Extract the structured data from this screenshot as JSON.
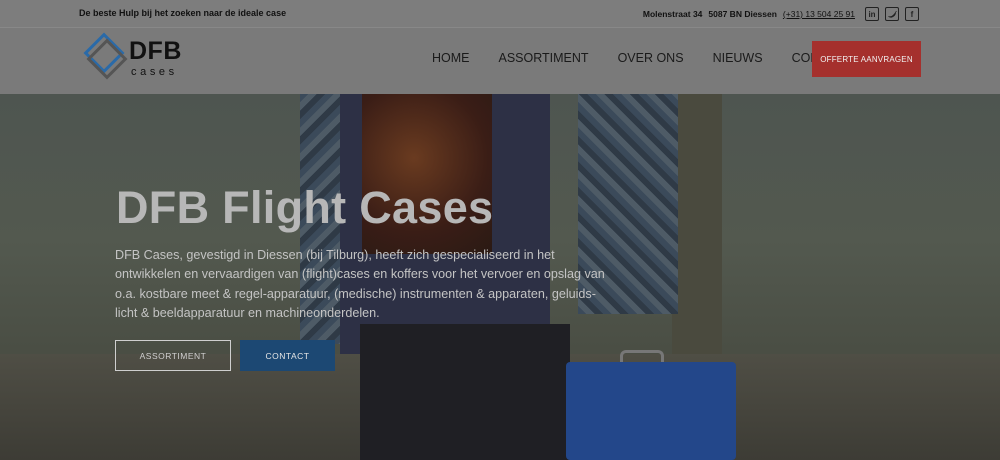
{
  "topbar": {
    "tagline": "De beste Hulp bij het zoeken naar de ideale case",
    "street": "Molenstraat 34",
    "city": "5087 BN Diessen",
    "phone": "(+31) 13 504 25 91",
    "social_icons": [
      "linkedin-icon",
      "twitter-icon",
      "facebook-icon"
    ]
  },
  "header": {
    "logo_main": "DFB",
    "logo_sub": "cases",
    "nav": [
      "HOME",
      "ASSORTIMENT",
      "OVER ONS",
      "NIEUWS",
      "CONTACT"
    ],
    "cta": "OFFERTE AANVRAGEN",
    "cta_color": "#a5302d",
    "logo_accent": "#2a6aa8"
  },
  "hero": {
    "title": "DFB Flight Cases",
    "text": "DFB Cases, gevestigd in Diessen (bij Tilburg), heeft zich gespecialiseerd in het ontwikkelen en vervaardigen van (flight)cases en koffers voor het vervoer en opslag van o.a. kostbare meet & regel-apparatuur, (medische) instrumenten & apparaten, geluids- licht & beeldapparatuur en machineonderdelen.",
    "button_primary": "ASSORTIMENT",
    "button_secondary": "CONTACT",
    "button_secondary_color": "#1c4873"
  }
}
